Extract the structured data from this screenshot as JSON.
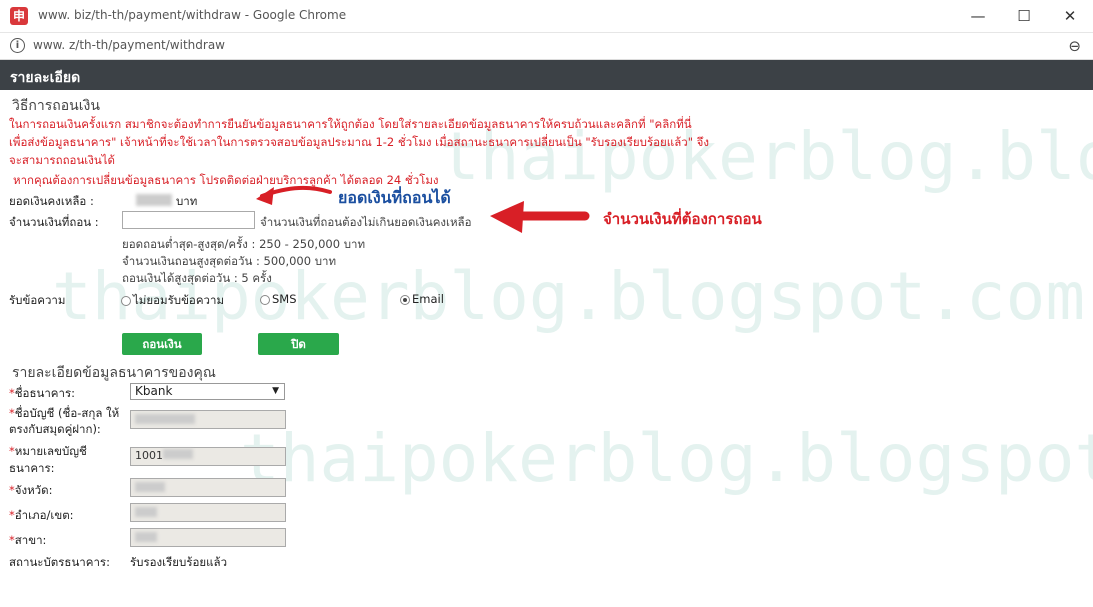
{
  "window": {
    "icon_glyph": "申",
    "title": "www.        biz/th-th/payment/withdraw - Google Chrome",
    "minimize_glyph": "—",
    "maximize_glyph": "☐",
    "close_glyph": "✕"
  },
  "address": {
    "info_glyph": "i",
    "url": "www.           z/th-th/payment/withdraw",
    "zoom_glyph": "⊖"
  },
  "header": {
    "title": "รายละเอียด"
  },
  "withdraw": {
    "section_title": "วิธีการถอนเงิน",
    "notice_line1": "ในการถอนเงินครั้งแรก สมาชิกจะต้องทำการยืนยันข้อมูลธนาคารให้ถูกต้อง โดยใส่รายละเอียดข้อมูลธนาคารให้ครบถ้วนและคลิกที่ \"คลิกที่นี่",
    "notice_line2": "เพื่อส่งข้อมูลธนาคาร\" เจ้าหน้าที่จะใช้เวลาในการตรวจสอบข้อมูลประมาณ 1-2 ชั่วโมง เมื่อสถานะธนาคารเปลี่ยนเป็น \"รับรองเรียบร้อยแล้ว\" จึง",
    "notice_line3": "จะสามารถถอนเงินได้",
    "contact_line": "หากคุณต้องการเปลี่ยนข้อมูลธนาคาร โปรดติดต่อฝ่ายบริการลูกค้า ได้ตลอด 24 ชั่วโมง",
    "balance_label": "ยอดเงินคงเหลือ :",
    "balance_currency": "บาท",
    "amount_label": "จำนวนเงินที่ถอน :",
    "amount_value": "",
    "amount_hint": "จำนวนเงินที่ถอนต้องไม่เกินยอดเงินคงเหลือ",
    "limit_range": "ยอดถอนต่ำสุด-สูงสุด/ครั้ง : 250 - 250,000 บาท",
    "limit_daily": "จำนวนเงินถอนสูงสุดต่อวัน : 500,000 บาท",
    "limit_count": "ถอนเงินได้สูงสุดต่อวัน : 5 ครั้ง",
    "notify_label": "รับข้อความ",
    "notify_options": [
      {
        "label": "ไม่ยอมรับข้อความ",
        "selected": false
      },
      {
        "label": "SMS",
        "selected": false
      },
      {
        "label": "Email",
        "selected": true
      }
    ],
    "withdraw_button": "ถอนเงิน",
    "close_button": "ปิด"
  },
  "annotations": {
    "balance_note": "ยอดเงินที่ถอนได้",
    "amount_note": "จำนวนเงินที่ต้องการถอน",
    "arrow_color": "#d81f26",
    "balance_note_color": "#1b4fa0"
  },
  "bank": {
    "section_title": "รายละเอียดข้อมูลธนาคารของคุณ",
    "required_mark": "*",
    "bank_name_label": "ชื่อธนาคาร:",
    "bank_name_value": "Kbank",
    "account_name_label_1": "ชื่อบัญชี (ชื่อ-สกุล ให้",
    "account_name_label_2": "ตรงกับสมุดคู่ฝาก):",
    "account_no_label_1": "หมายเลขบัญชี",
    "account_no_label_2": "ธนาคาร:",
    "account_no_value_prefix": "1001",
    "province_label": "จังหวัด:",
    "district_label": "อำเภอ/เขต:",
    "branch_label": "สาขา:",
    "status_label": "สถานะบัตรธนาคาร:",
    "status_value": "รับรองเรียบร้อยแล้ว"
  },
  "watermark": {
    "text": "thaipokerblog.blogspot.com"
  }
}
